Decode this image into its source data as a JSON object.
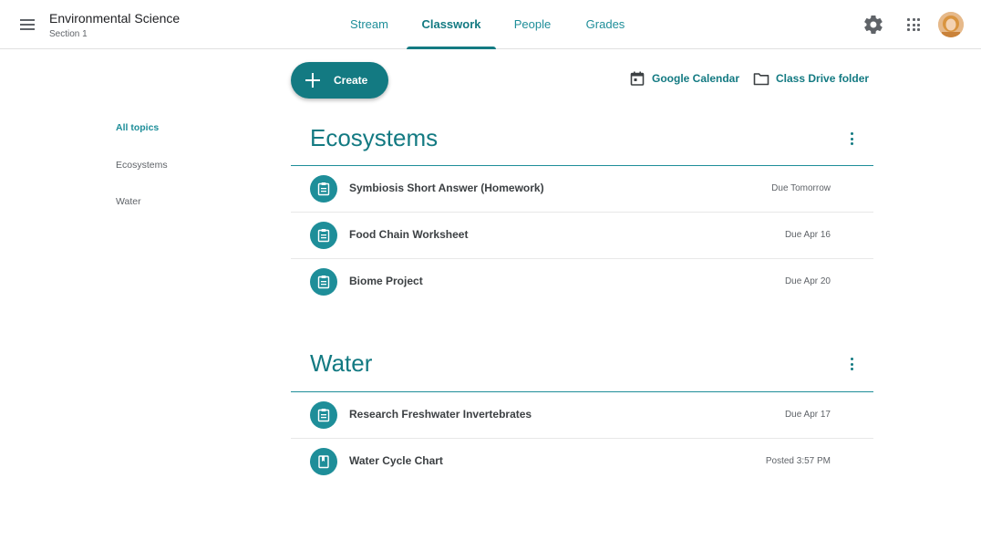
{
  "header": {
    "class_name": "Environmental Science",
    "section": "Section 1",
    "tabs": [
      {
        "label": "Stream",
        "active": false
      },
      {
        "label": "Classwork",
        "active": true
      },
      {
        "label": "People",
        "active": false
      },
      {
        "label": "Grades",
        "active": false
      }
    ],
    "accent_color": "#137a82"
  },
  "toolbar": {
    "create_label": "Create",
    "calendar_label": "Google Calendar",
    "drive_label": "Class Drive folder"
  },
  "sidebar": {
    "items": [
      {
        "label": "All topics",
        "active": true
      },
      {
        "label": "Ecosystems",
        "active": false
      },
      {
        "label": "Water",
        "active": false
      }
    ]
  },
  "topics": [
    {
      "title": "Ecosystems",
      "items": [
        {
          "name": "Symbiosis Short Answer (Homework)",
          "status": "Due Tomorrow",
          "icon": "assignment-icon"
        },
        {
          "name": "Food Chain Worksheet",
          "status": "Due Apr 16",
          "icon": "assignment-icon"
        },
        {
          "name": "Biome Project",
          "status": "Due Apr 20",
          "icon": "assignment-icon"
        }
      ]
    },
    {
      "title": "Water",
      "items": [
        {
          "name": "Research Freshwater Invertebrates",
          "status": "Due Apr 17",
          "icon": "assignment-icon"
        },
        {
          "name": "Water Cycle Chart",
          "status": "Posted 3:57 PM",
          "icon": "material-icon"
        }
      ]
    }
  ]
}
